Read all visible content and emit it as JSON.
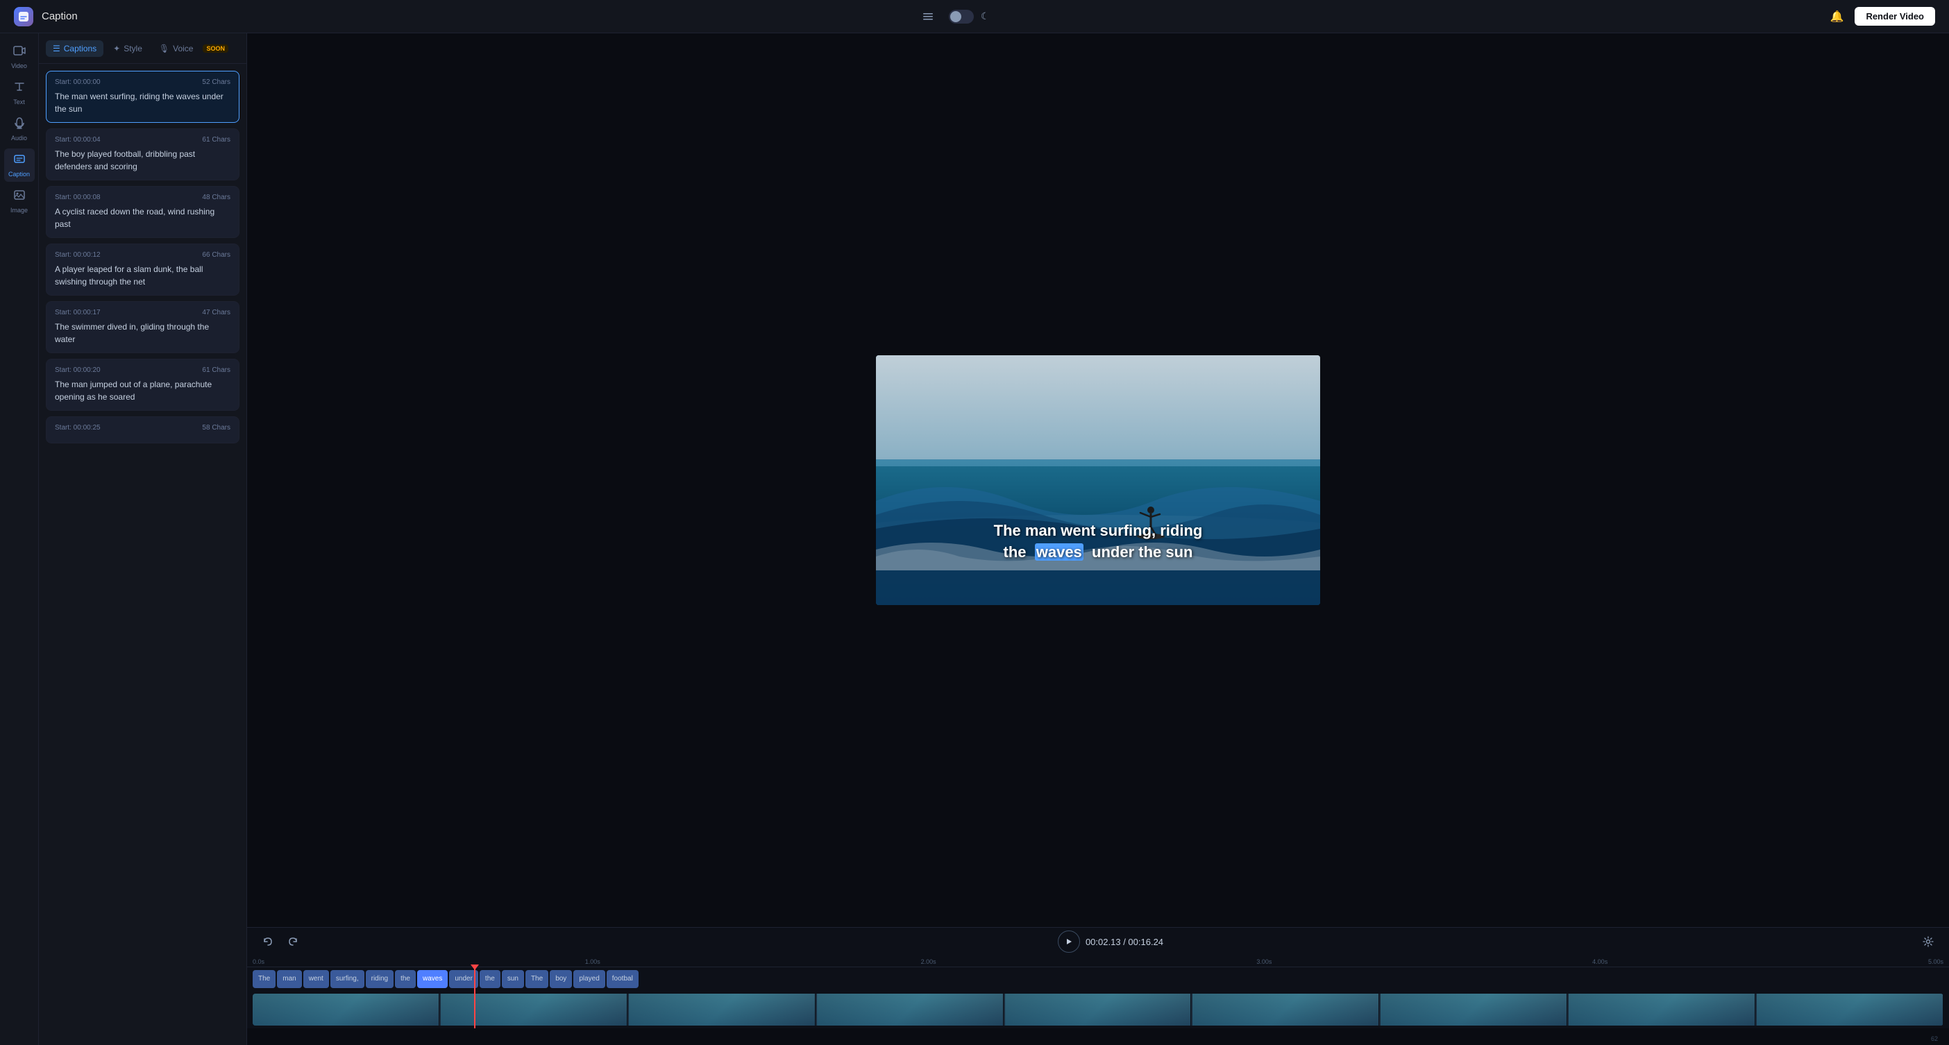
{
  "app": {
    "logo": "C",
    "title": "Caption",
    "render_button": "Render Video"
  },
  "icon_sidebar": {
    "items": [
      {
        "id": "video",
        "icon": "▣",
        "label": "Video",
        "active": false
      },
      {
        "id": "text",
        "icon": "T",
        "label": "Text",
        "active": false
      },
      {
        "id": "audio",
        "icon": "♪",
        "label": "Audio",
        "active": false
      },
      {
        "id": "caption",
        "icon": "☰",
        "label": "Caption",
        "active": true
      },
      {
        "id": "image",
        "icon": "⬜",
        "label": "Image",
        "active": false
      }
    ]
  },
  "panel": {
    "tabs": [
      {
        "id": "captions",
        "icon": "☰",
        "label": "Captions",
        "active": true
      },
      {
        "id": "style",
        "icon": "✦",
        "label": "Style",
        "active": false
      },
      {
        "id": "voice",
        "icon": "🎙",
        "label": "Voice",
        "active": false
      },
      {
        "id": "soon",
        "label": "SOON",
        "badge": true
      }
    ]
  },
  "captions": [
    {
      "id": 1,
      "start": "Start: 00:00:00",
      "chars": "52 Chars",
      "text": "The man went surfing, riding the waves under the sun",
      "selected": true
    },
    {
      "id": 2,
      "start": "Start: 00:00:04",
      "chars": "61 Chars",
      "text": "The boy played football, dribbling past defenders and scoring",
      "selected": false
    },
    {
      "id": 3,
      "start": "Start: 00:00:08",
      "chars": "48 Chars",
      "text": "A cyclist raced down the road, wind rushing past",
      "selected": false
    },
    {
      "id": 4,
      "start": "Start: 00:00:12",
      "chars": "66 Chars",
      "text": "A player leaped for a slam dunk, the ball swishing through the net",
      "selected": false
    },
    {
      "id": 5,
      "start": "Start: 00:00:17",
      "chars": "47 Chars",
      "text": "The swimmer dived in, gliding through the water",
      "selected": false
    },
    {
      "id": 6,
      "start": "Start: 00:00:20",
      "chars": "61 Chars",
      "text": "The man jumped out of a plane, parachute opening as he soared",
      "selected": false
    },
    {
      "id": 7,
      "start": "Start: 00:00:25",
      "chars": "58 Chars",
      "text": "",
      "selected": false
    }
  ],
  "video": {
    "caption_line1": "The man went surfing, riding",
    "caption_line2_before": "the",
    "caption_highlight": "waves",
    "caption_line2_after": "under the sun"
  },
  "timeline": {
    "undo_label": "↩",
    "redo_label": "↪",
    "play_icon": "▶",
    "current_time": "00:02.13",
    "total_time": "00:16.24",
    "settings_icon": "⚙",
    "ruler_marks": [
      "0.0s",
      "1.00s",
      "2.00s",
      "3.00s",
      "4.00s",
      "5.00s"
    ],
    "words": [
      "The",
      "man",
      "went",
      "surfing,",
      "riding",
      "the",
      "waves",
      "under",
      "the",
      "sun",
      "The",
      "boy",
      "played",
      "footbal"
    ],
    "highlighted_word": "waves",
    "frame_count": "62"
  }
}
